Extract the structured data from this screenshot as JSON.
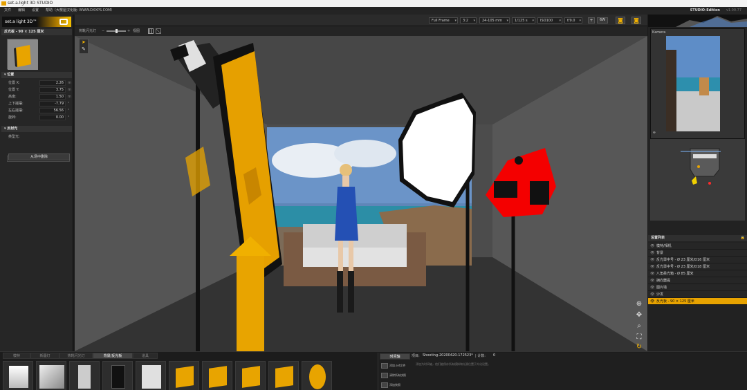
{
  "window": {
    "title": "set.a.light 3D STUDIO"
  },
  "menu": {
    "items": [
      "文件",
      "编辑",
      "设置",
      "帮助（大樱屋汉化版: WWW.DXXPS.COM）"
    ],
    "edition": "STUDIO-Edition",
    "version": "v1.00.77"
  },
  "toolbar": {
    "frame": "Full Frame",
    "ratio": "3:2",
    "lens": "24-105 mm",
    "shutter": "1/125 s",
    "iso": "ISO100",
    "aperture": "f/9.0",
    "plus": "+",
    "wb": "6W",
    "camera_icon": "camera-icon",
    "flash_icon": "flash-camera-icon"
  },
  "subbar": {
    "label": "热靴闪光灯",
    "minus": "−",
    "plus": "+",
    "view": "视图"
  },
  "left": {
    "logo": "set.a light 3D™",
    "tool_icons": [
      "pointer-icon",
      "pencil-icon"
    ],
    "panel_title": "反光板 - 90 × 125 厘米",
    "position_header": "位置",
    "rows": [
      {
        "label": "位置 X:",
        "value": "2.26",
        "unit": "m"
      },
      {
        "label": "位置 Y:",
        "value": "3.75",
        "unit": "m"
      },
      {
        "label": "高度:",
        "value": "1.50",
        "unit": "m"
      },
      {
        "label": "上下摇摆:",
        "value": "-7.79",
        "unit": "°"
      },
      {
        "label": "左右摇摆:",
        "value": "56.56",
        "unit": "°"
      },
      {
        "label": "旋转:",
        "value": "0.00",
        "unit": "°"
      }
    ],
    "reflector_header": "反射光",
    "type_label": "类型光:",
    "type_value": "金色",
    "remove_button": "从场中删除"
  },
  "right": {
    "camera_label": "Kamera",
    "set_list_title": "设置列表",
    "items": [
      {
        "label": "模特/相机"
      },
      {
        "label": "背景"
      },
      {
        "label": "反光罩中号 - Ø 23 厘米/D16 厘米"
      },
      {
        "label": "反光罩中号 - Ø 23 厘米/D18 厘米"
      },
      {
        "label": "八角柔光箱 - Ø 85 厘米"
      },
      {
        "label": "拥向器提"
      },
      {
        "label": "图片墙"
      },
      {
        "label": "沙发"
      },
      {
        "label": "反光板 - 90 × 125 厘米",
        "selected": true
      }
    ]
  },
  "bottom": {
    "tabs": [
      "模特",
      "新器灯",
      "热靴闪光灯",
      "背景/反光板",
      "道具"
    ],
    "active_tab": 3,
    "timeline_tab": "时间轴",
    "project_label": "项目:",
    "project_value": "Shooting-20200420-172523*",
    "count_label": "| 计数:",
    "count_value": "0",
    "actions": [
      "添加.set文件",
      "清除所有快照",
      "添加快照"
    ],
    "hint": "添加为时间轴，他们能保存所有模拟和光源位置于外化设置。"
  }
}
